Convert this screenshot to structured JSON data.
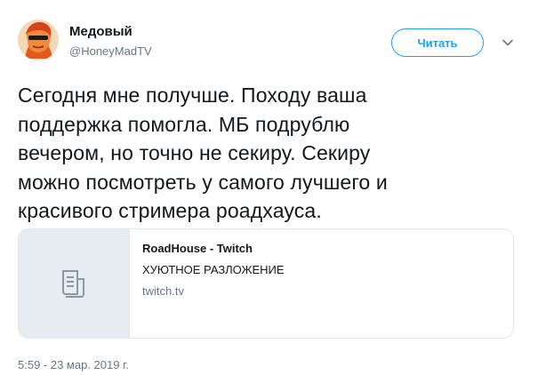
{
  "author": {
    "name": "Медовый",
    "handle": "@HoneyMadTV"
  },
  "follow_button": {
    "label": "Читать"
  },
  "tweet": {
    "text": "Сегодня мне получше. Походу ваша\nподдержка помогла. МБ подрублю\nвечером, но точно не секиру. Секиру\nможно посмотреть у самого лучшего и\nкрасивого стримера роадхауса."
  },
  "link_card": {
    "title": "RoadHouse - Twitch",
    "description": "ХУЮТНОЕ РАЗЛОЖЕНИЕ",
    "domain": "twitch.tv",
    "thumbnail_icon": "document-icon"
  },
  "timestamp": "5:59 - 23 мар. 2019 г.",
  "colors": {
    "accent": "#1da1f2",
    "secondary_text": "#657786",
    "primary_text": "#14171a",
    "card_border": "#e1e8ed",
    "thumb_bg": "#e6ecf0"
  }
}
